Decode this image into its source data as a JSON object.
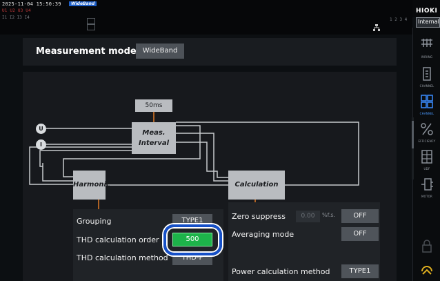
{
  "status": {
    "timestamp": "2025-11-04 15:50:39",
    "mode_tag": "WideBand",
    "red_indicators": "U1 U2 U3 U4",
    "gray_indicators": "I1 I2 I3 I4",
    "right_indicators": "1 2 3 4"
  },
  "brand": {
    "logo": "HIOKI"
  },
  "tabs": {
    "internal": "Internal"
  },
  "sidebar": {
    "items": [
      {
        "label": "WIRING",
        "icon": "wiring-icon"
      },
      {
        "label": "CHANNEL",
        "icon": "channel-icon"
      },
      {
        "label": "CHANNEL",
        "icon": "channel-grid-icon"
      },
      {
        "label": "EFFICIENCY",
        "icon": "efficiency-icon"
      },
      {
        "label": "UDF",
        "icon": "udf-icon"
      },
      {
        "label": "MOTOR",
        "icon": "motor-icon"
      },
      {
        "label": "",
        "icon": "sync-icon"
      }
    ]
  },
  "main": {
    "measurement_mode_label": "Measurement mode",
    "measurement_mode_value": "WideBand"
  },
  "diagram": {
    "interval_value": "50ms",
    "meas_interval_label_1": "Meas.",
    "meas_interval_label_2": "Interval",
    "input_u": "U",
    "input_i": "I",
    "harmonic_label": "Harmonic",
    "calculation_label": "Calculation"
  },
  "harmonic_settings": {
    "grouping_label": "Grouping",
    "grouping_value": "TYPE1",
    "thd_order_label": "THD calculation order",
    "thd_order_value": "500",
    "thd_method_label": "THD calculation method",
    "thd_method_value": "THD-F"
  },
  "calculation_settings": {
    "zero_suppress_label": "Zero suppress",
    "zero_suppress_value": "0.00",
    "zero_suppress_unit": "%f.s.",
    "zero_suppress_state": "OFF",
    "averaging_label": "Averaging mode",
    "averaging_state": "OFF",
    "power_method_label": "Power calculation method",
    "power_method_value": "TYPE1"
  },
  "colors": {
    "accent_green": "#1db34a",
    "highlight_blue": "#1650c8",
    "mode_tag_blue": "#1e5fc8",
    "connector_orange": "#e07a26"
  }
}
